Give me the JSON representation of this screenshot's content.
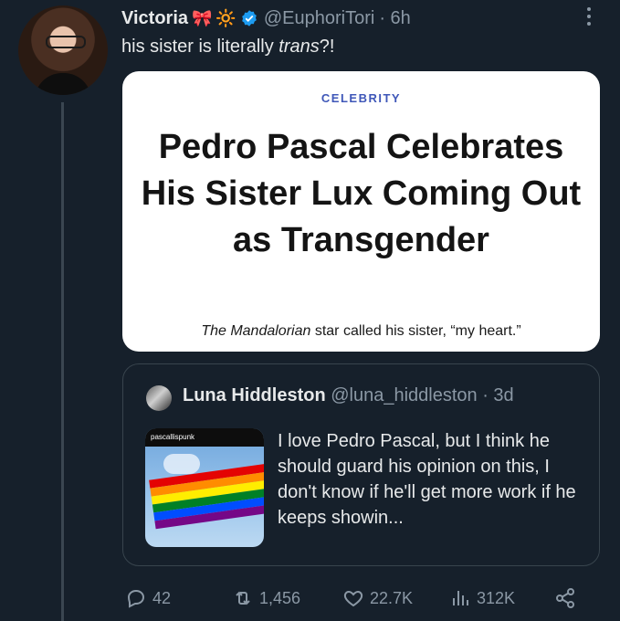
{
  "tweet": {
    "author_name": "Victoria",
    "author_emojis": [
      "🎀",
      "🔆"
    ],
    "handle": "@EuphoriTori",
    "time": "· 6h",
    "text_prefix": "his sister is literally ",
    "text_italic": "trans",
    "text_suffix": "?!"
  },
  "article_card": {
    "category": "CELEBRITY",
    "headline": "Pedro Pascal Celebrates His Sister Lux Coming Out as Transgender",
    "dek_italic": "The Mandalorian",
    "dek_rest": " star called his sister, “my heart.”"
  },
  "quoted_tweet": {
    "author_name": "Luna Hiddleston",
    "handle": "@luna_hiddleston",
    "time": "· 3d",
    "thumbnail_caption": "pascallispunk",
    "text": "I love Pedro Pascal, but I think he should guard his opinion on this, I don't know if he'll get more work if he keeps showin..."
  },
  "actions": {
    "replies": "42",
    "retweets": "1,456",
    "likes": "22.7K",
    "views": "312K"
  },
  "colors": {
    "background": "#16202b",
    "verified": "#1d9bf0",
    "secondary_text": "#8b98a5",
    "category_blue": "#3f57b8"
  }
}
